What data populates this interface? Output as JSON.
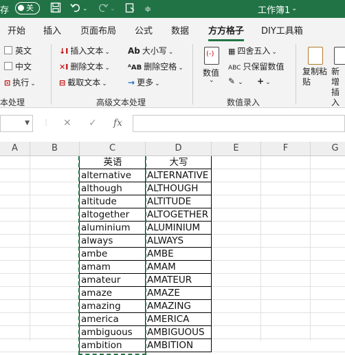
{
  "titlebar": {
    "autosave_label": "存",
    "toggle_label": "关",
    "workbook_title": "工作簿1",
    "title_caret": "⌄"
  },
  "tabs": [
    {
      "label": "开始"
    },
    {
      "label": "插入"
    },
    {
      "label": "页面布局"
    },
    {
      "label": "公式"
    },
    {
      "label": "数据"
    },
    {
      "label": "方方格子"
    },
    {
      "label": "DIY工具箱"
    }
  ],
  "ribbon": {
    "group1": {
      "english": "英文",
      "chinese": "中文",
      "execute": "执行",
      "group_label": "本处理"
    },
    "group2": {
      "insert_text": "插入文本",
      "delete_text": "删除文本",
      "cut_text": "截取文本",
      "case": "大小写",
      "delete_space": "删除空格",
      "more": "更多",
      "group_label": "高级文本处理"
    },
    "group3": {
      "numeric": "数值",
      "round": "四舍五入",
      "keep_numeric": "只保留数值",
      "group_label": "数值录入"
    },
    "group4": {
      "copy_paste": "复制粘贴",
      "new_insert": "新增插入"
    }
  },
  "formula_bar": {
    "cancel": "✕",
    "confirm": "✓",
    "fx": "fx",
    "value": ""
  },
  "columns": [
    "A",
    "B",
    "C",
    "D",
    "E",
    "F",
    "G"
  ],
  "table": {
    "header": [
      "英语",
      "大写"
    ],
    "rows": [
      [
        "alternative",
        "ALTERNATIVE"
      ],
      [
        "although",
        "ALTHOUGH"
      ],
      [
        "altitude",
        "ALTITUDE"
      ],
      [
        "altogether",
        "ALTOGETHER"
      ],
      [
        "aluminium",
        "ALUMINIUM"
      ],
      [
        "always",
        "ALWAYS"
      ],
      [
        "ambe",
        "AMBE"
      ],
      [
        "amam",
        "AMAM"
      ],
      [
        "amateur",
        "AMATEUR"
      ],
      [
        "amaze",
        "AMAZE"
      ],
      [
        "amazing",
        "AMAZING"
      ],
      [
        "america",
        "AMERICA"
      ],
      [
        "ambiguous",
        "AMBIGUOUS"
      ],
      [
        "ambition",
        "AMBITION"
      ]
    ]
  },
  "colors": {
    "brand_green": "#217346",
    "selection_dash": "#217346"
  }
}
